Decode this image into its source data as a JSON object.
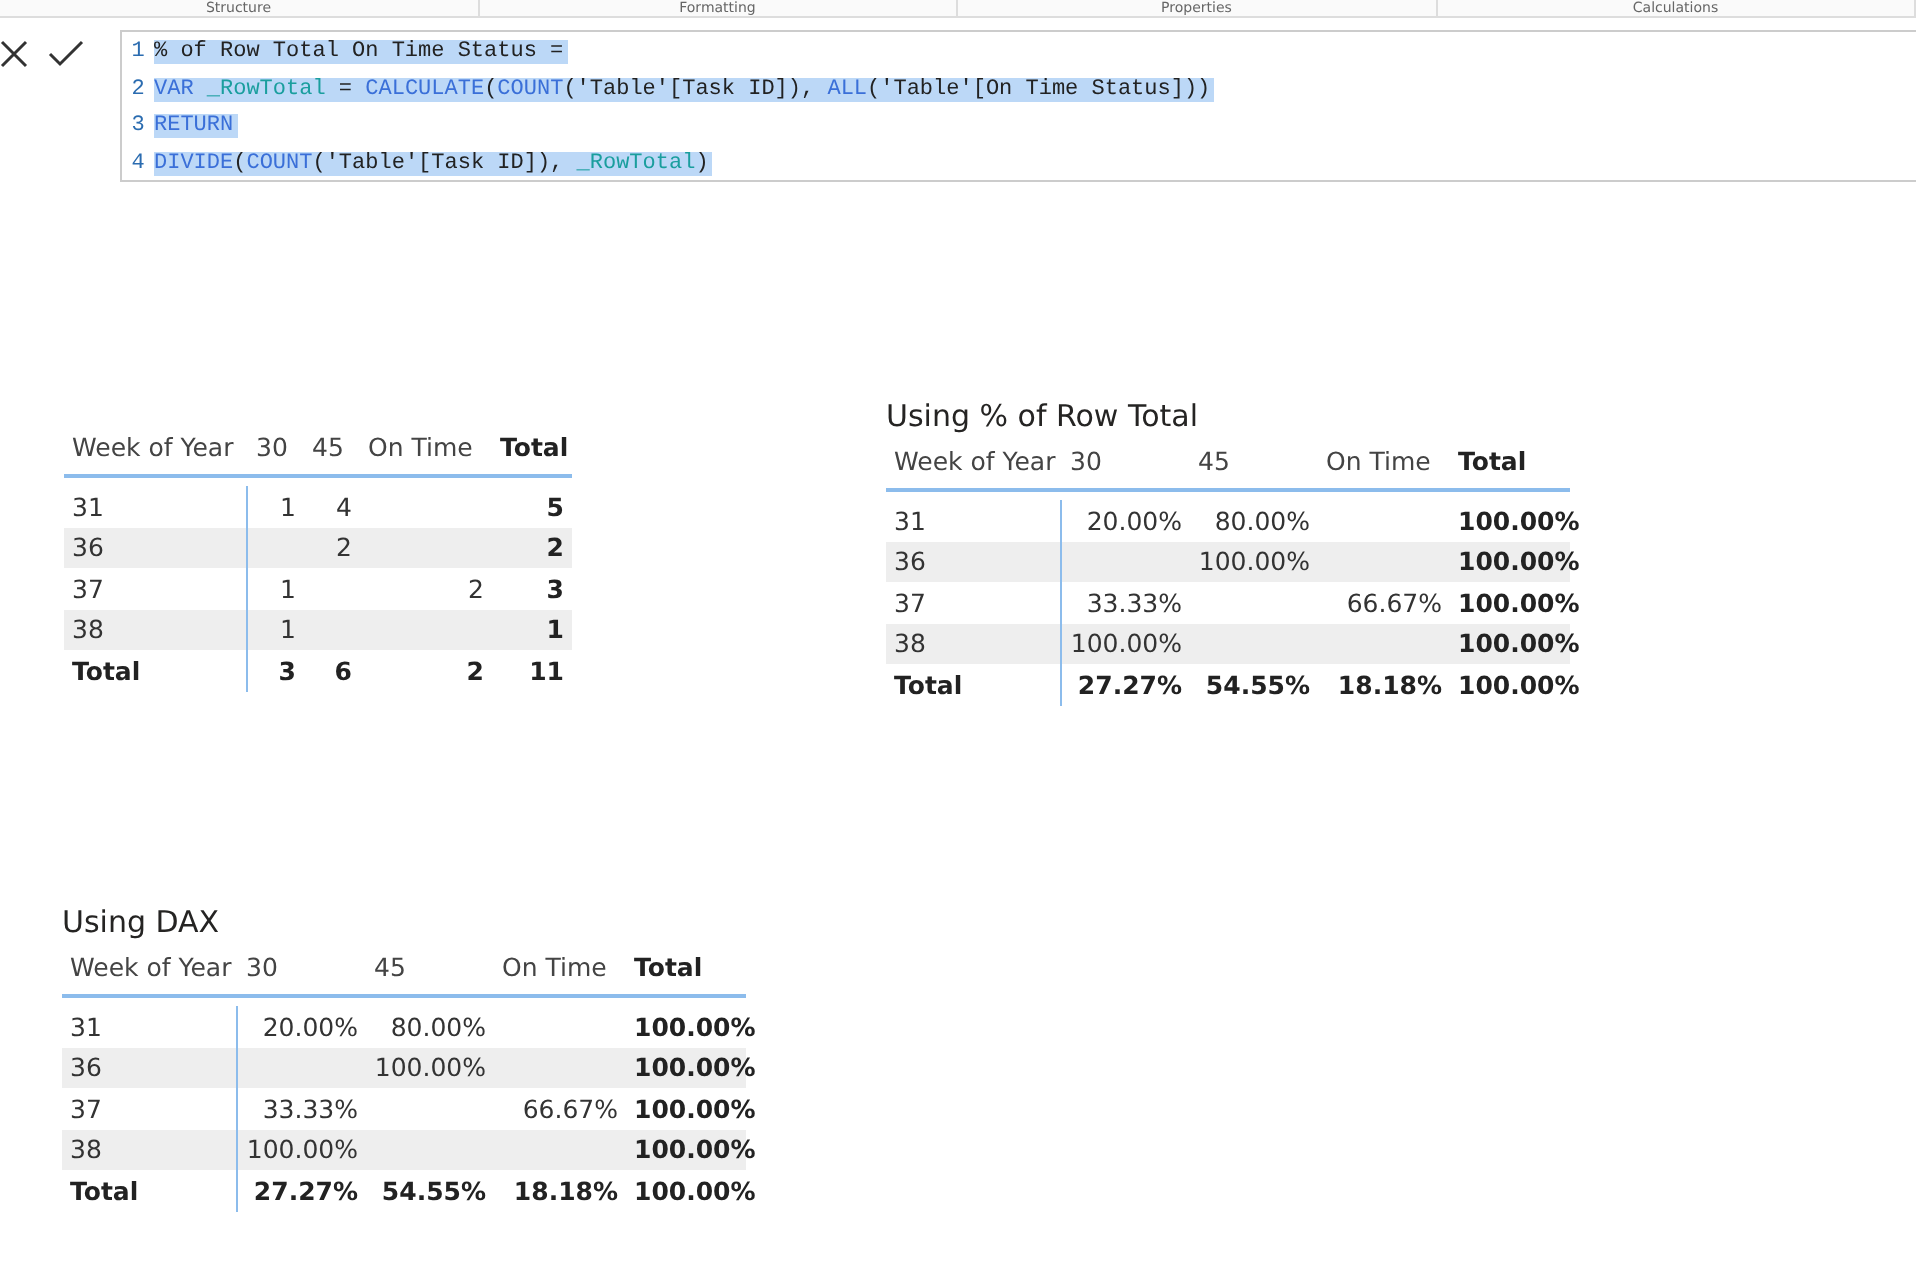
{
  "ribbon_tabs": [
    "Structure",
    "Formatting",
    "Properties",
    "Calculations"
  ],
  "formula_bar": {
    "lines": [
      {
        "number": "1",
        "tokens": [
          {
            "kind": "text",
            "text": "% of Row Total On Time Status ="
          }
        ]
      },
      {
        "number": "2",
        "tokens": [
          {
            "kind": "keyword",
            "text": "VAR "
          },
          {
            "kind": "variable",
            "text": "_RowTotal"
          },
          {
            "kind": "text",
            "text": " = "
          },
          {
            "kind": "keyword",
            "text": "CALCULATE"
          },
          {
            "kind": "text",
            "text": "("
          },
          {
            "kind": "keyword",
            "text": "COUNT"
          },
          {
            "kind": "text",
            "text": "('Table'[Task ID]), "
          },
          {
            "kind": "keyword",
            "text": "ALL"
          },
          {
            "kind": "text",
            "text": "('Table'[On Time Status]))"
          }
        ]
      },
      {
        "number": "3",
        "tokens": [
          {
            "kind": "keyword",
            "text": "RETURN"
          }
        ]
      },
      {
        "number": "4",
        "tokens": [
          {
            "kind": "keyword",
            "text": "DIVIDE"
          },
          {
            "kind": "text",
            "text": "("
          },
          {
            "kind": "keyword",
            "text": "COUNT"
          },
          {
            "kind": "text",
            "text": "('Table'[Task ID]), "
          },
          {
            "kind": "variable",
            "text": "_RowTotal"
          },
          {
            "kind": "text",
            "text": ")"
          }
        ]
      }
    ]
  },
  "matrices": [
    {
      "columns": [
        {
          "label": "Week of Year",
          "kind": "row_header"
        },
        {
          "label": "30",
          "kind": "value"
        },
        {
          "label": "45",
          "kind": "value"
        },
        {
          "label": "On Time",
          "kind": "value"
        },
        {
          "label": "Total",
          "kind": "total"
        }
      ],
      "rows": [
        {
          "kind": "data",
          "cells": [
            "31",
            "1",
            "4",
            "",
            "5"
          ]
        },
        {
          "kind": "data",
          "cells": [
            "36",
            "",
            "2",
            "",
            "2"
          ]
        },
        {
          "kind": "data",
          "cells": [
            "37",
            "1",
            "",
            "2",
            "3"
          ]
        },
        {
          "kind": "data",
          "cells": [
            "38",
            "1",
            "",
            "",
            "1"
          ]
        },
        {
          "kind": "total",
          "cells": [
            "Total",
            "3",
            "6",
            "2",
            "11"
          ]
        }
      ]
    },
    {
      "title": "Using % of Row Total",
      "columns": [
        {
          "label": "Week of Year",
          "kind": "row_header"
        },
        {
          "label": "30",
          "kind": "value"
        },
        {
          "label": "45",
          "kind": "value"
        },
        {
          "label": "On Time",
          "kind": "value"
        },
        {
          "label": "Total",
          "kind": "total"
        }
      ],
      "rows": [
        {
          "kind": "data",
          "cells": [
            "31",
            "20.00%",
            "80.00%",
            "",
            "100.00%"
          ]
        },
        {
          "kind": "data",
          "cells": [
            "36",
            "",
            "100.00%",
            "",
            "100.00%"
          ]
        },
        {
          "kind": "data",
          "cells": [
            "37",
            "33.33%",
            "",
            "66.67%",
            "100.00%"
          ]
        },
        {
          "kind": "data",
          "cells": [
            "38",
            "100.00%",
            "",
            "",
            "100.00%"
          ]
        },
        {
          "kind": "total",
          "cells": [
            "Total",
            "27.27%",
            "54.55%",
            "18.18%",
            "100.00%"
          ]
        }
      ]
    },
    {
      "title": "Using DAX",
      "columns": [
        {
          "label": "Week of Year",
          "kind": "row_header"
        },
        {
          "label": "30",
          "kind": "value"
        },
        {
          "label": "45",
          "kind": "value"
        },
        {
          "label": "On Time",
          "kind": "value"
        },
        {
          "label": "Total",
          "kind": "total"
        }
      ],
      "rows": [
        {
          "kind": "data",
          "cells": [
            "31",
            "20.00%",
            "80.00%",
            "",
            "100.00%"
          ]
        },
        {
          "kind": "data",
          "cells": [
            "36",
            "",
            "100.00%",
            "",
            "100.00%"
          ]
        },
        {
          "kind": "data",
          "cells": [
            "37",
            "33.33%",
            "",
            "66.67%",
            "100.00%"
          ]
        },
        {
          "kind": "data",
          "cells": [
            "38",
            "100.00%",
            "",
            "",
            "100.00%"
          ]
        },
        {
          "kind": "total",
          "cells": [
            "Total",
            "27.27%",
            "54.55%",
            "18.18%",
            "100.00%"
          ]
        }
      ]
    }
  ]
}
